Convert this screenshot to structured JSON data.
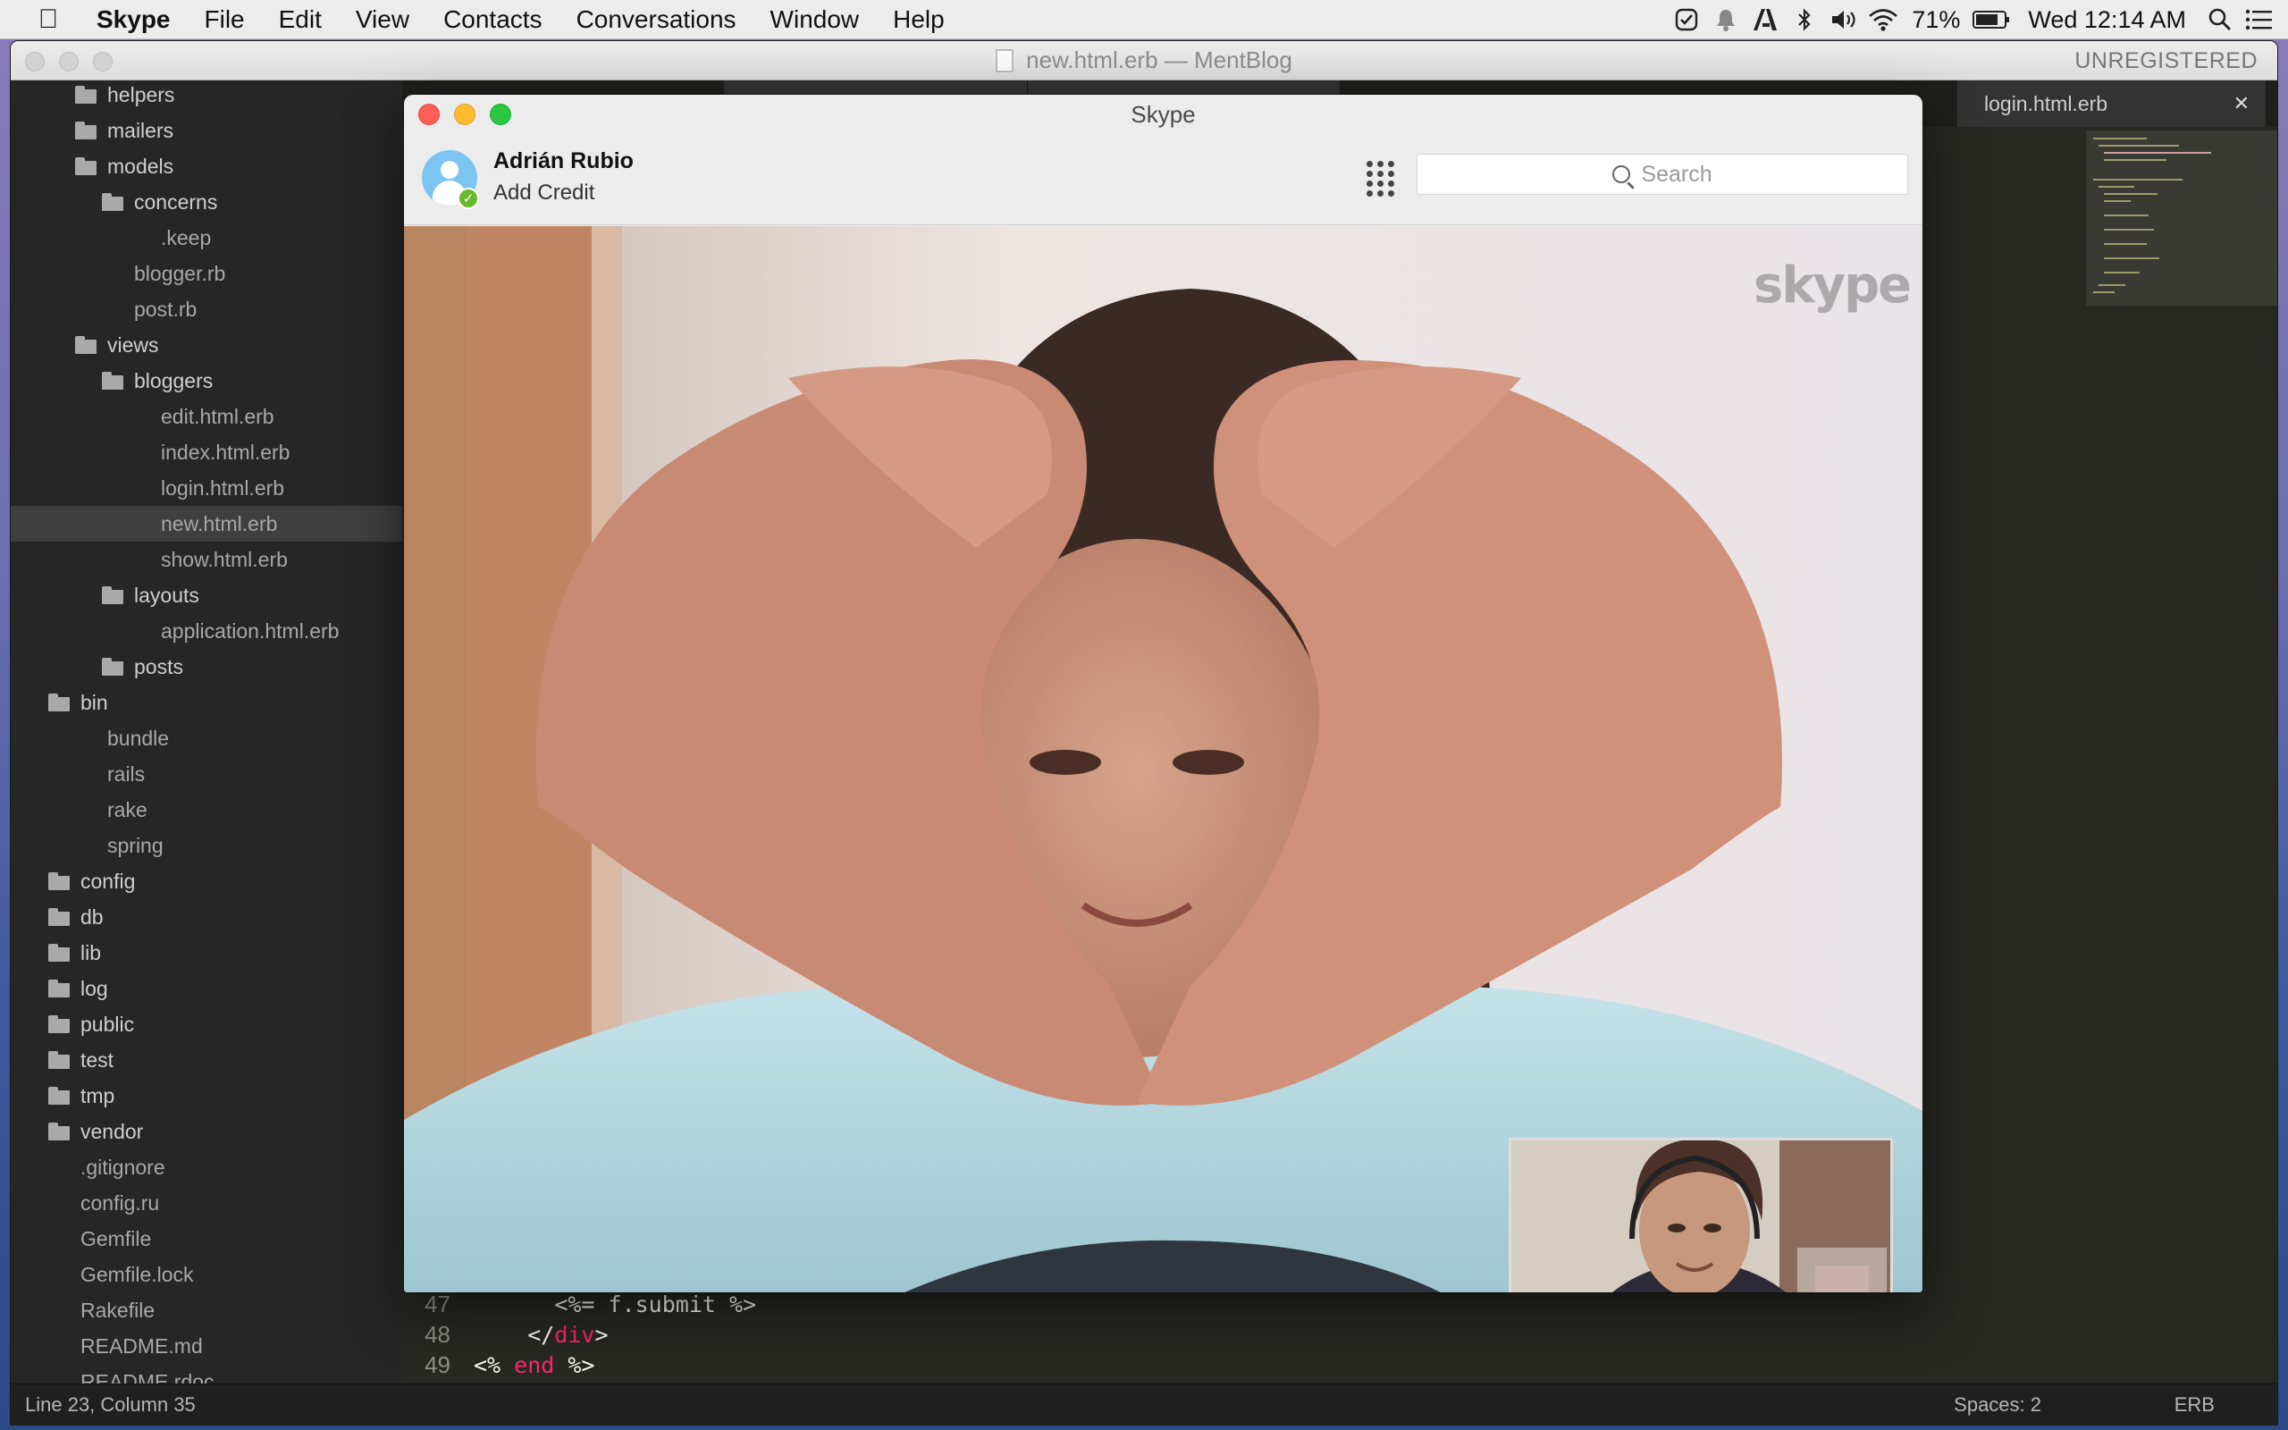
{
  "menubar": {
    "app_name": "Skype",
    "menus": [
      "File",
      "Edit",
      "View",
      "Contacts",
      "Conversations",
      "Window",
      "Help"
    ],
    "battery": "71%",
    "clock": "Wed 12:14 AM"
  },
  "editor": {
    "window_title": "new.html.erb — MentBlog",
    "license": "UNREGISTERED",
    "tabs": [
      {
        "label": "login.html.erb"
      }
    ],
    "sidebar": [
      {
        "label": "helpers",
        "type": "folder",
        "depth": 1
      },
      {
        "label": "mailers",
        "type": "folder",
        "depth": 1
      },
      {
        "label": "models",
        "type": "folder-open",
        "depth": 1
      },
      {
        "label": "concerns",
        "type": "folder",
        "depth": 2
      },
      {
        "label": ".keep",
        "type": "file",
        "depth": 3
      },
      {
        "label": "blogger.rb",
        "type": "file",
        "depth": 2
      },
      {
        "label": "post.rb",
        "type": "file",
        "depth": 2
      },
      {
        "label": "views",
        "type": "folder-open",
        "depth": 1
      },
      {
        "label": "bloggers",
        "type": "folder-open",
        "depth": 2
      },
      {
        "label": "edit.html.erb",
        "type": "file",
        "depth": 3
      },
      {
        "label": "index.html.erb",
        "type": "file",
        "depth": 3
      },
      {
        "label": "login.html.erb",
        "type": "file",
        "depth": 3
      },
      {
        "label": "new.html.erb",
        "type": "file",
        "depth": 3,
        "selected": true
      },
      {
        "label": "show.html.erb",
        "type": "file",
        "depth": 3
      },
      {
        "label": "layouts",
        "type": "folder-open",
        "depth": 2
      },
      {
        "label": "application.html.erb",
        "type": "file",
        "depth": 3
      },
      {
        "label": "posts",
        "type": "folder",
        "depth": 2
      },
      {
        "label": "bin",
        "type": "folder-open",
        "depth": 0
      },
      {
        "label": "bundle",
        "type": "file",
        "depth": 1
      },
      {
        "label": "rails",
        "type": "file",
        "depth": 1
      },
      {
        "label": "rake",
        "type": "file",
        "depth": 1
      },
      {
        "label": "spring",
        "type": "file",
        "depth": 1
      },
      {
        "label": "config",
        "type": "folder",
        "depth": 0
      },
      {
        "label": "db",
        "type": "folder",
        "depth": 0
      },
      {
        "label": "lib",
        "type": "folder",
        "depth": 0
      },
      {
        "label": "log",
        "type": "folder",
        "depth": 0
      },
      {
        "label": "public",
        "type": "folder",
        "depth": 0
      },
      {
        "label": "test",
        "type": "folder",
        "depth": 0
      },
      {
        "label": "tmp",
        "type": "folder",
        "depth": 0
      },
      {
        "label": "vendor",
        "type": "folder",
        "depth": 0
      },
      {
        "label": ".gitignore",
        "type": "file",
        "depth": 0
      },
      {
        "label": "config.ru",
        "type": "file",
        "depth": 0
      },
      {
        "label": "Gemfile",
        "type": "file",
        "depth": 0
      },
      {
        "label": "Gemfile.lock",
        "type": "file",
        "depth": 0
      },
      {
        "label": "Rakefile",
        "type": "file",
        "depth": 0
      },
      {
        "label": "README.md",
        "type": "file",
        "depth": 0
      },
      {
        "label": "README.rdoc",
        "type": "file",
        "depth": 0
      }
    ],
    "code": [
      {
        "num": "47",
        "text": "<%= f.submit %>"
      },
      {
        "num": "48",
        "pre": "</",
        "tag": "div",
        "post": ">"
      },
      {
        "num": "49",
        "pre": "<% ",
        "tag": "end",
        "post": " %>"
      }
    ],
    "status": {
      "position": "Line 23, Column 35",
      "spaces": "Spaces: 2",
      "syntax": "ERB"
    }
  },
  "skype": {
    "window_title": "Skype",
    "user_name": "Adrián Rubio",
    "credit_link": "Add Credit",
    "search_placeholder": "Search",
    "watermark": "skype"
  }
}
